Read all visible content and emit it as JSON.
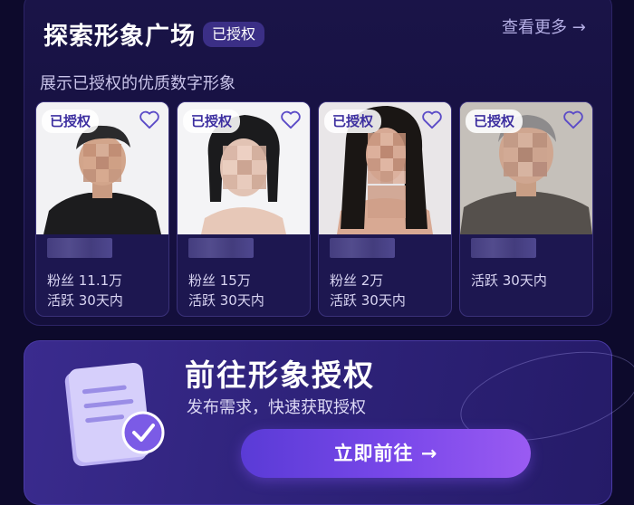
{
  "section": {
    "title": "探索形象广场",
    "title_badge": "已授权",
    "more_link": "查看更多 →",
    "subtitle": "展示已授权的优质数字形象"
  },
  "cards": [
    {
      "badge": "已授权",
      "fans": "粉丝 11.1万",
      "active": "活跃 30天内"
    },
    {
      "badge": "已授权",
      "fans": "粉丝 15万",
      "active": "活跃 30天内"
    },
    {
      "badge": "已授权",
      "fans": "粉丝 2万",
      "active": "活跃 30天内"
    },
    {
      "badge": "已授权",
      "active": "活跃 30天内"
    }
  ],
  "cta": {
    "title": "前往形象授权",
    "desc": "发布需求，快速获取授权",
    "button": "立即前往 →"
  },
  "colors": {
    "background": "#0d0a2c",
    "accent": "#7a48ea",
    "badge_text": "#3d2fa0"
  },
  "icons": [
    "heart-icon",
    "document-icon",
    "check-icon",
    "arrow-right-icon"
  ]
}
